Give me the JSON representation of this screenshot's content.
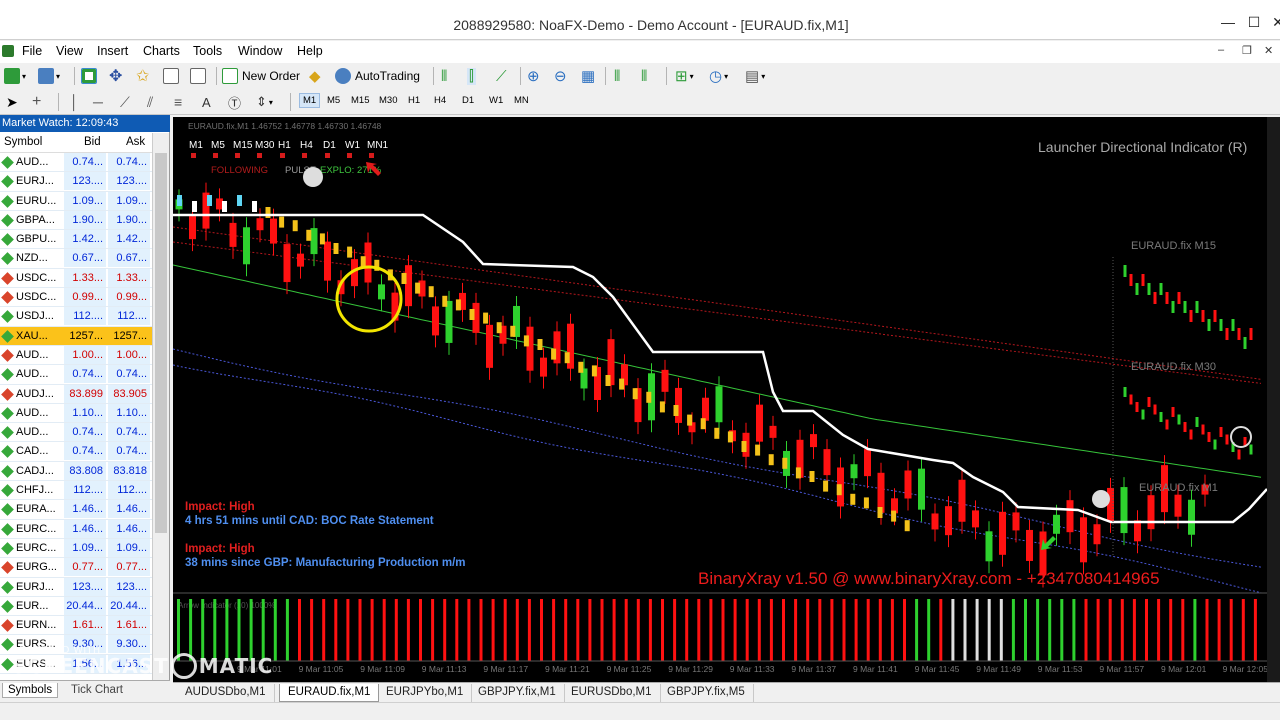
{
  "window": {
    "title": "2088929580: NoaFX-Demo - Demo Account - [EURAUD.fix,M1]",
    "controls": [
      "—",
      "☐",
      "✕"
    ],
    "mdi_controls": [
      "–",
      "❐",
      "✕"
    ]
  },
  "menu": {
    "items": [
      "File",
      "View",
      "Insert",
      "Charts",
      "Tools",
      "Window",
      "Help"
    ]
  },
  "toolbar": {
    "new_order": "New Order",
    "autotrading": "AutoTrading",
    "timeframes": [
      "M1",
      "M5",
      "M15",
      "M30",
      "H1",
      "H4",
      "D1",
      "W1",
      "MN"
    ],
    "search_placeholder": ""
  },
  "market_watch": {
    "title": "Market Watch: 12:09:43",
    "columns": [
      "Symbol",
      "Bid",
      "Ask"
    ],
    "rows": [
      {
        "symbol": "AUD...",
        "bid": "0.74...",
        "ask": "0.74...",
        "dir": "up"
      },
      {
        "symbol": "EURJ...",
        "bid": "123....",
        "ask": "123....",
        "dir": "up"
      },
      {
        "symbol": "EURU...",
        "bid": "1.09...",
        "ask": "1.09...",
        "dir": "up"
      },
      {
        "symbol": "GBPA...",
        "bid": "1.90...",
        "ask": "1.90...",
        "dir": "up"
      },
      {
        "symbol": "GBPU...",
        "bid": "1.42...",
        "ask": "1.42...",
        "dir": "up"
      },
      {
        "symbol": "NZD...",
        "bid": "0.67...",
        "ask": "0.67...",
        "dir": "up"
      },
      {
        "symbol": "USDC...",
        "bid": "1.33...",
        "ask": "1.33...",
        "dir": "dn"
      },
      {
        "symbol": "USDC...",
        "bid": "0.99...",
        "ask": "0.99...",
        "dir": "dn"
      },
      {
        "symbol": "USDJ...",
        "bid": "112....",
        "ask": "112....",
        "dir": "up"
      },
      {
        "symbol": "XAU...",
        "bid": "1257...",
        "ask": "1257...",
        "dir": "sel"
      },
      {
        "symbol": "AUD...",
        "bid": "1.00...",
        "ask": "1.00...",
        "dir": "dn"
      },
      {
        "symbol": "AUD...",
        "bid": "0.74...",
        "ask": "0.74...",
        "dir": "up"
      },
      {
        "symbol": "AUDJ...",
        "bid": "83.899",
        "ask": "83.905",
        "dir": "dn"
      },
      {
        "symbol": "AUD...",
        "bid": "1.10...",
        "ask": "1.10...",
        "dir": "up"
      },
      {
        "symbol": "AUD...",
        "bid": "0.74...",
        "ask": "0.74...",
        "dir": "up"
      },
      {
        "symbol": "CAD...",
        "bid": "0.74...",
        "ask": "0.74...",
        "dir": "up"
      },
      {
        "symbol": "CADJ...",
        "bid": "83.808",
        "ask": "83.818",
        "dir": "up"
      },
      {
        "symbol": "CHFJ...",
        "bid": "112....",
        "ask": "112....",
        "dir": "up"
      },
      {
        "symbol": "EURA...",
        "bid": "1.46...",
        "ask": "1.46...",
        "dir": "up"
      },
      {
        "symbol": "EURC...",
        "bid": "1.46...",
        "ask": "1.46...",
        "dir": "up"
      },
      {
        "symbol": "EURC...",
        "bid": "1.09...",
        "ask": "1.09...",
        "dir": "up"
      },
      {
        "symbol": "EURG...",
        "bid": "0.77...",
        "ask": "0.77...",
        "dir": "dn"
      },
      {
        "symbol": "EURJ...",
        "bid": "123....",
        "ask": "123....",
        "dir": "up"
      },
      {
        "symbol": "EUR...",
        "bid": "20.44...",
        "ask": "20.44...",
        "dir": "up"
      },
      {
        "symbol": "EURN...",
        "bid": "1.61...",
        "ask": "1.61...",
        "dir": "dn"
      },
      {
        "symbol": "EURS...",
        "bid": "9.30...",
        "ask": "9.30...",
        "dir": "up"
      },
      {
        "symbol": "EURS...",
        "bid": "1.56...",
        "ask": "1.56...",
        "dir": "up"
      }
    ],
    "tabs": [
      "Symbols",
      "Tick Chart"
    ]
  },
  "chart": {
    "header": "EURAUD.fix,M1  1.46752 1.46778 1.46730 1.46748",
    "tf_row": [
      "M1",
      "M5",
      "M15",
      "M30",
      "H1",
      "H4",
      "D1",
      "W1",
      "MN1"
    ],
    "status_labels": {
      "trend": "FOLLOWING",
      "pulse": "PULSE",
      "explo": "EXPLO: 271%"
    },
    "indicator_title": "Launcher Directional Indicator (R)",
    "mini_labels": [
      "EURAUD.fix M15",
      "EURAUD.fix M30",
      "EURAUD.fix M1"
    ],
    "news": [
      {
        "impact": "Impact: High",
        "text": "4 hrs 51 mins until CAD: BOC Rate Statement"
      },
      {
        "impact": "Impact: High",
        "text": "38 mins since GBP: Manufacturing Production m/m"
      }
    ],
    "brand_text": "BinaryXray v1.50 @ www.binaryXray.com - +2347080414965",
    "subwindow_label": "Arrow Indicator (10) 1000%",
    "time_labels": [
      "9 Mar 11:01",
      "9 Mar 11:05",
      "9 Mar 11:09",
      "9 Mar 11:13",
      "9 Mar 11:17",
      "9 Mar 11:21",
      "9 Mar 11:25",
      "9 Mar 11:29",
      "9 Mar 11:33",
      "9 Mar 11:37",
      "9 Mar 11:41",
      "9 Mar 11:45",
      "9 Mar 11:49",
      "9 Mar 11:53",
      "9 Mar 11:57",
      "9 Mar 12:01",
      "9 Mar 12:05"
    ],
    "colors": {
      "bull": "#2ed12e",
      "bear": "#ff1111",
      "dots": "#f4c21a",
      "line": "#ffffff",
      "ma": "#36c33a",
      "band": "#4a57d8",
      "redband": "#b3171d"
    }
  },
  "bottom_tabs": [
    "AUDUSDbo,M1",
    "EURAUD.fix,M1",
    "EURJPYbo,M1",
    "GBPJPY.fix,M1",
    "EURUSDbo,M1",
    "GBPJPY.fix,M5"
  ],
  "bottom_tabs_active": 1,
  "watermark": {
    "line1": "RECORDED WITH",
    "line2a": "SCREENCAST",
    "line2b": "MATIC"
  }
}
